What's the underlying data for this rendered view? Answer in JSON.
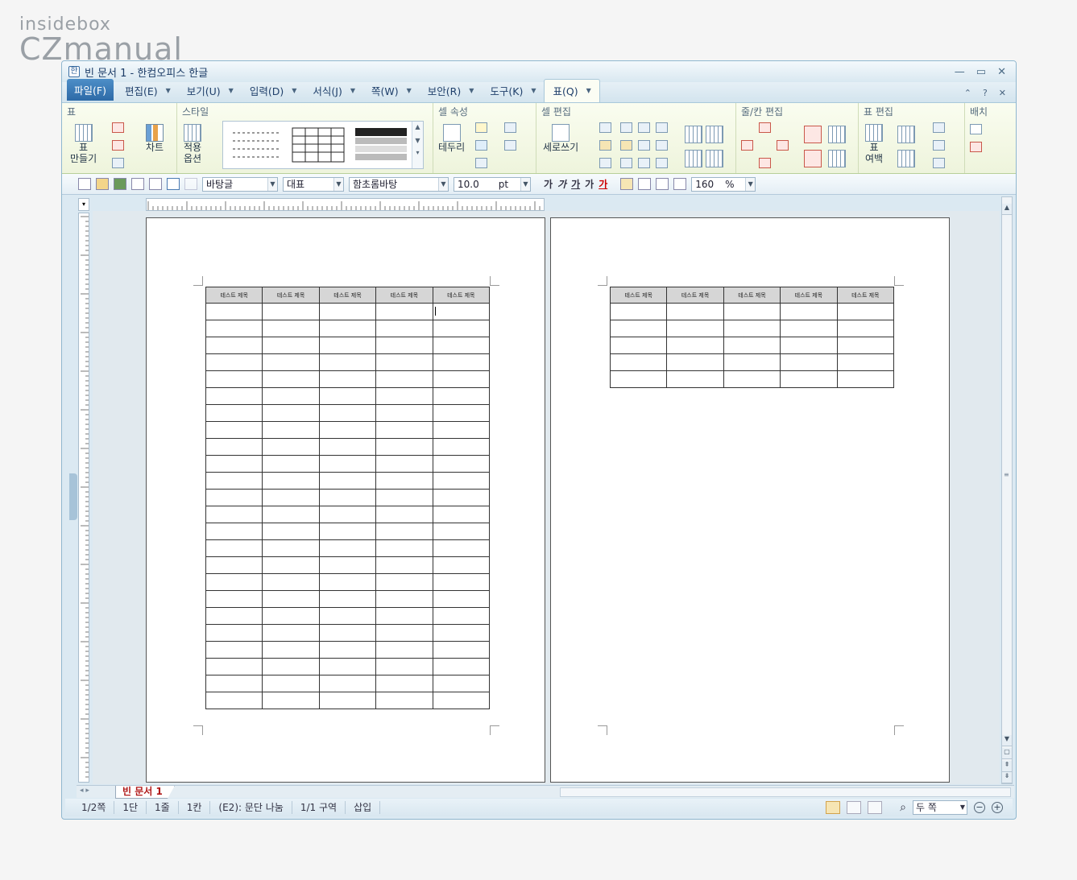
{
  "brand": {
    "line1": "insidebox",
    "line2": "CZmanual"
  },
  "window": {
    "title": "빈 문서 1 - 한컴오피스 한글",
    "controls": {
      "minimize": "—",
      "restore": "▭",
      "close": "✕"
    }
  },
  "menus": [
    {
      "label": "파일(F)"
    },
    {
      "label": "편집(E)"
    },
    {
      "label": "보기(U)"
    },
    {
      "label": "입력(D)"
    },
    {
      "label": "서식(J)"
    },
    {
      "label": "쪽(W)"
    },
    {
      "label": "보안(R)"
    },
    {
      "label": "도구(K)"
    },
    {
      "label": "표(Q)"
    }
  ],
  "menu_right": {
    "up": "⌃",
    "help": "?",
    "close": "✕"
  },
  "ribbon": {
    "groups": {
      "table": "표",
      "style": "스타일",
      "cell_props": "셀 속성",
      "cell_edit": "셀 편집",
      "rowcol_edit": "줄/칸 편집",
      "table_edit": "표 편집",
      "arrange": "배치"
    },
    "buttons": {
      "make_table": "표\n만들기",
      "chart": "차트",
      "apply_options": "적용\n옵션",
      "border": "테두리",
      "vertical_write": "세로쓰기",
      "table_margin": "표\n여백"
    }
  },
  "toolbar": {
    "style": "바탕글",
    "language": "대표",
    "font": "함초롬바탕",
    "size": "10.0",
    "size_unit": "pt",
    "bold": "가",
    "italic": "가",
    "underline": "가",
    "strike": "가",
    "color": "가",
    "line_spacing": "160",
    "line_spacing_unit": "%"
  },
  "table_header": [
    "테스트 제목",
    "테스트 제목",
    "테스트 제목",
    "테스트 제목",
    "테스트 제목"
  ],
  "page1_rows": 24,
  "page2_rows": 5,
  "doc_tab": "빈 문서 1",
  "status": {
    "page": "1/2쪽",
    "column": "1단",
    "line": "1줄",
    "col": "1칸",
    "cell": "(E2): 문단 나눔",
    "section": "1/1 구역",
    "mode": "삽입",
    "zoom": "두 쪽"
  }
}
